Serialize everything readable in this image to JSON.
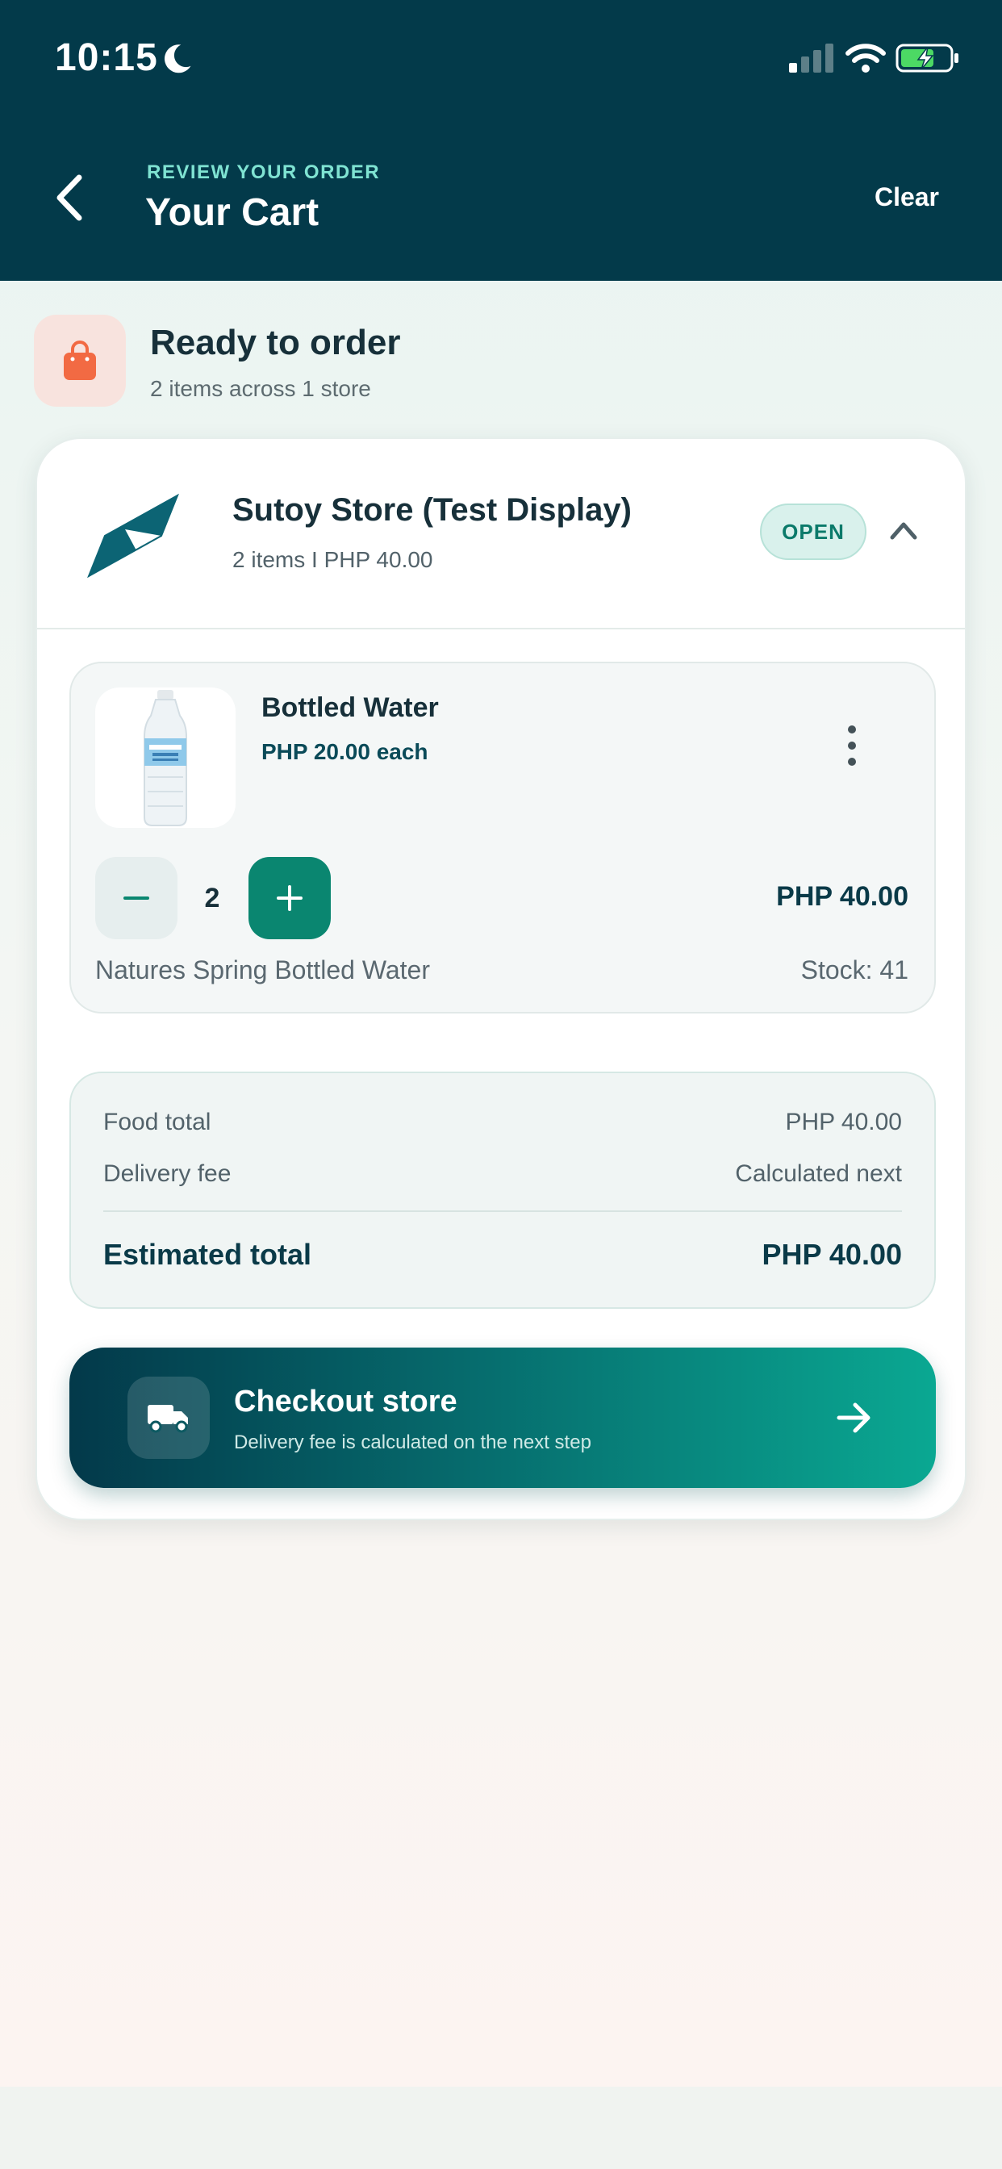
{
  "status_bar": {
    "time": "10:15"
  },
  "header": {
    "subtitle": "REVIEW YOUR ORDER",
    "title": "Your Cart",
    "clear_label": "Clear"
  },
  "summary_banner": {
    "title": "Ready to order",
    "subtitle": "2 items across 1 store",
    "icon": "shopping-bag-icon"
  },
  "store": {
    "name": "Sutoy Store (Test Display)",
    "meta": "2 items  I  PHP 40.00",
    "status": "OPEN",
    "items": [
      {
        "name": "Bottled Water",
        "unit_price": "PHP 20.00 each",
        "quantity": "2",
        "line_total": "PHP 40.00",
        "description": "Natures Spring Bottled Water",
        "stock": "Stock: 41"
      }
    ]
  },
  "order_summary": {
    "food_total_label": "Food total",
    "food_total_value": "PHP 40.00",
    "delivery_fee_label": "Delivery fee",
    "delivery_fee_value": "Calculated next",
    "estimated_total_label": "Estimated total",
    "estimated_total_value": "PHP 40.00"
  },
  "checkout": {
    "title": "Checkout store",
    "subtitle": "Delivery fee is calculated on the next step",
    "icon": "truck-icon"
  },
  "colors": {
    "header_bg": "#033a4a",
    "accent_teal": "#0a8670",
    "accent_mint": "#7fe3d2",
    "bag_orange": "#f26a43"
  }
}
